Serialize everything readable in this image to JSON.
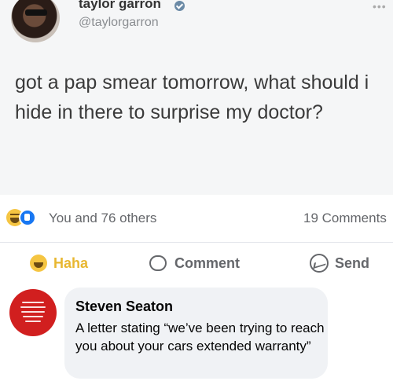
{
  "tweet": {
    "name": "taylor garron",
    "handle": "@taylorgarron",
    "more": "•••",
    "text": "got a pap smear tomorrow, what should i hide in there to surprise my doctor?"
  },
  "reactions": {
    "summary": "You and 76 others",
    "comments": "19 Comments"
  },
  "actions": {
    "haha": "Haha",
    "comment": "Comment",
    "send": "Send"
  },
  "comment": {
    "author": "Steven Seaton",
    "text": "A letter stating “we’ve been trying to reach you about your cars extended warranty”"
  },
  "colors": {
    "facebook_blue": "#1877f2",
    "haha_yellow": "#f5c542",
    "avatar_red": "#d11f1f"
  }
}
